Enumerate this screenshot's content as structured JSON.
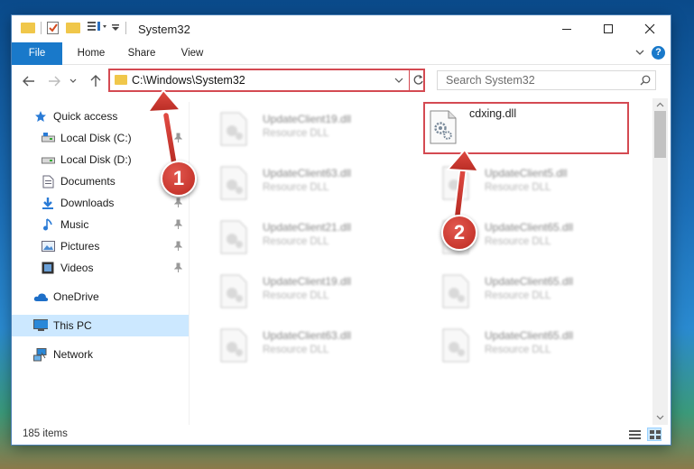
{
  "window": {
    "title": "System32",
    "colors": {
      "accent": "#1979ca",
      "highlight": "#d44a52",
      "selected": "#cce8ff"
    }
  },
  "ribbon": {
    "tabs": [
      {
        "label": "File"
      },
      {
        "label": "Home"
      },
      {
        "label": "Share"
      },
      {
        "label": "View"
      }
    ]
  },
  "address": {
    "path": "C:\\Windows\\System32",
    "search_placeholder": "Search System32"
  },
  "sidebar": {
    "items": [
      {
        "label": "Quick access",
        "icon": "star-icon"
      },
      {
        "label": "Local Disk (C:)",
        "icon": "drive-icon",
        "pinned": true
      },
      {
        "label": "Local Disk (D:)",
        "icon": "drive-icon",
        "pinned": false
      },
      {
        "label": "Documents",
        "icon": "documents-icon",
        "pinned": true
      },
      {
        "label": "Downloads",
        "icon": "download-icon",
        "pinned": true
      },
      {
        "label": "Music",
        "icon": "music-icon",
        "pinned": true
      },
      {
        "label": "Pictures",
        "icon": "pictures-icon",
        "pinned": true
      },
      {
        "label": "Videos",
        "icon": "videos-icon",
        "pinned": true
      },
      {
        "label": "OneDrive",
        "icon": "cloud-icon"
      },
      {
        "label": "This PC",
        "icon": "computer-icon",
        "selected": true
      },
      {
        "label": "Network",
        "icon": "network-icon"
      }
    ]
  },
  "files": [
    {
      "name": "UpdateClient19.dll",
      "type": "Resource DLL"
    },
    {
      "name": "cdxing.dll",
      "type": ""
    },
    {
      "name": "UpdateClient63.dll",
      "type": "Resource DLL"
    },
    {
      "name": "UpdateClient5.dll",
      "type": "Resource DLL"
    },
    {
      "name": "UpdateClient21.dll",
      "type": "Resource DLL"
    },
    {
      "name": "UpdateClient65.dll",
      "type": "Resource DLL"
    },
    {
      "name": "UpdateClient19.dll",
      "type": "Resource DLL"
    },
    {
      "name": "UpdateClient65.dll",
      "type": "Resource DLL"
    },
    {
      "name": "UpdateClient63.dll",
      "type": "Resource DLL"
    },
    {
      "name": "UpdateClient65.dll",
      "type": "Resource DLL"
    }
  ],
  "status": {
    "items_count": "185 items"
  },
  "callouts": [
    {
      "number": "1"
    },
    {
      "number": "2"
    }
  ]
}
